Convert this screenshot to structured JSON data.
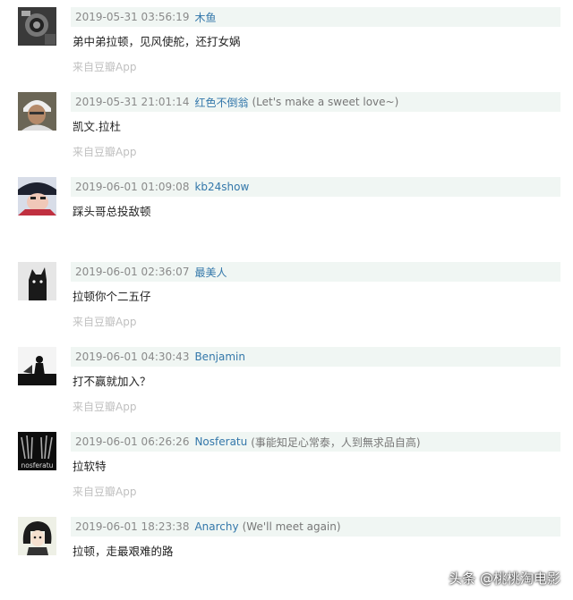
{
  "comments": [
    {
      "time": "2019-05-31 03:56:19",
      "user": "木鱼",
      "signature": "",
      "text": "弟中弟拉顿，见风使舵，还打女娲",
      "source": "来自豆瓣App",
      "avatar_icon": "gray-camera-avatar"
    },
    {
      "time": "2019-05-31 21:01:14",
      "user": "红色不倒翁",
      "signature": "(Let's make a sweet love~)",
      "text": "凯文.拉杜",
      "source": "来自豆瓣App",
      "avatar_icon": "person-portrait-avatar"
    },
    {
      "time": "2019-06-01 01:09:08",
      "user": "kb24show",
      "signature": "",
      "text": "踩头哥总投敌顿",
      "source": "",
      "avatar_icon": "anime-character-avatar"
    },
    {
      "time": "2019-06-01 02:36:07",
      "user": "最美人",
      "signature": "",
      "text": "拉顿你个二五仔",
      "source": "来自豆瓣App",
      "avatar_icon": "dog-silhouette-avatar"
    },
    {
      "time": "2019-06-01 04:30:43",
      "user": "Benjamin",
      "signature": "",
      "text": "打不赢就加入？",
      "source": "来自豆瓣App",
      "avatar_icon": "black-white-scene-avatar"
    },
    {
      "time": "2019-06-01 06:26:26",
      "user": "Nosferatu",
      "signature": "(事能知足心常泰，人到無求品自高)",
      "text": "拉软特",
      "source": "来自豆瓣App",
      "avatar_icon": "nosferatu-avatar",
      "avatar_text": "nosferatu"
    },
    {
      "time": "2019-06-01 18:23:38",
      "user": "Anarchy",
      "signature": "(We'll meet again)",
      "text": "拉顿，走最艰难的路",
      "source": "",
      "avatar_icon": "anime-girl-avatar"
    }
  ],
  "watermark": "头条 @桃桃淘电影"
}
